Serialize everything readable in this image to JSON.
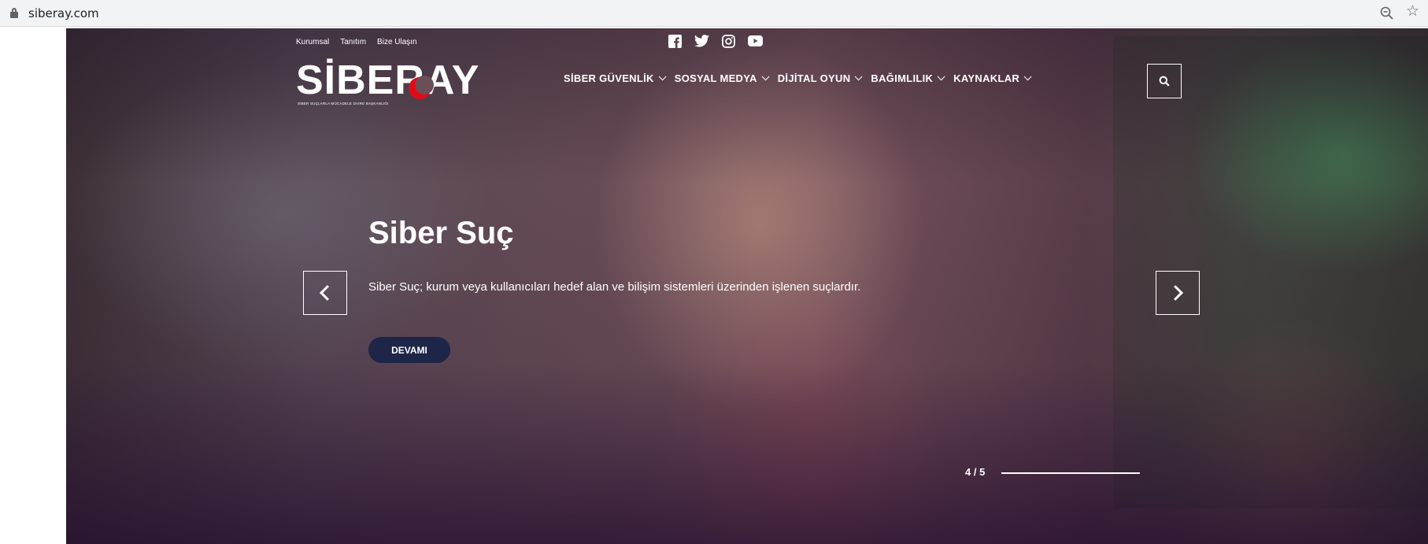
{
  "browser": {
    "url": "siberay.com",
    "lock_icon": "lock-icon",
    "zoom_icon": "zoom-out-icon",
    "bookmark_icon": "star-icon"
  },
  "header": {
    "top_links": [
      "Kurumsal",
      "Tanıtım",
      "Bize Ulaşın"
    ],
    "social": [
      "facebook-icon",
      "twitter-icon",
      "instagram-icon",
      "youtube-icon"
    ],
    "logo": {
      "text": "SİBERAY",
      "tagline": "SİBER SUÇLARLA MÜCADELE DAİRE BAŞKANLIĞI"
    },
    "nav": [
      {
        "label": "SİBER GÜVENLİK"
      },
      {
        "label": "SOSYAL MEDYA"
      },
      {
        "label": "DİJİTAL OYUN"
      },
      {
        "label": "BAĞIMLILIK"
      },
      {
        "label": "KAYNAKLAR"
      }
    ],
    "search_icon": "search-icon"
  },
  "slider": {
    "title": "Siber Suç",
    "text": "Siber Suç; kurum veya kullanıcıları hedef alan ve bilişim sistemleri üzerinden işlenen suçlardır.",
    "button": "DEVAMI",
    "counter": "4 / 5",
    "current": 4,
    "total": 5,
    "progress_fraction": 1.0
  },
  "colors": {
    "button_bg": "#1d2548",
    "logo_accent": "#e30a17",
    "text": "#ffffff"
  }
}
